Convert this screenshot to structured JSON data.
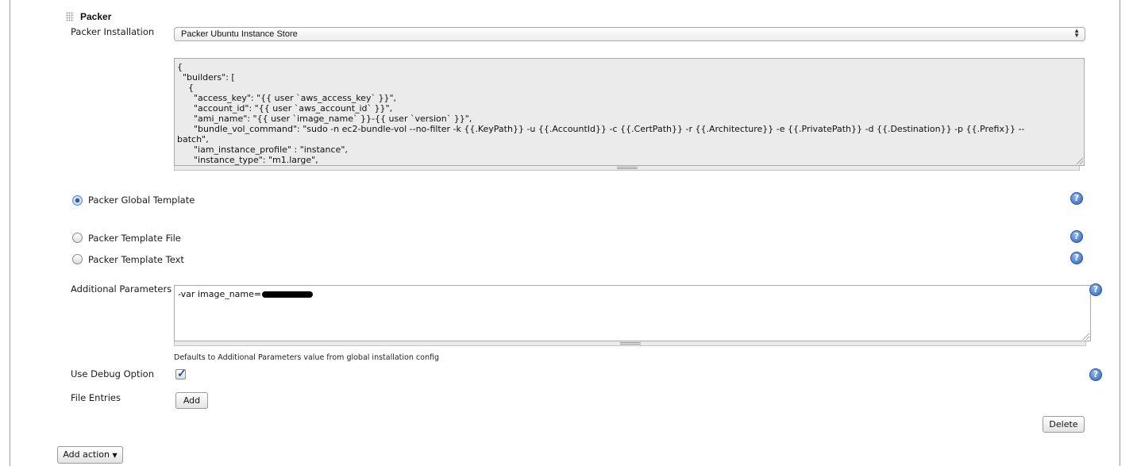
{
  "section": {
    "title": "Packer"
  },
  "installation": {
    "label": "Packer Installation",
    "selected": "Packer Ubuntu Instance Store"
  },
  "template_preview": {
    "lines": [
      "{",
      "  \"builders\": [",
      "    {",
      "      \"access_key\": \"{{ user `aws_access_key` }}\",",
      "      \"account_id\": \"{{ user `aws_account_id` }}\",",
      "      \"ami_name\": \"{{ user `image_name` }}-{{ user `version` }}\",",
      "      \"bundle_vol_command\": \"sudo -n ec2-bundle-vol --no-filter -k {{.KeyPath}} -u {{.AccountId}} -c {{.CertPath}} -r {{.Architecture}} -e {{.PrivatePath}} -d {{.Destination}} -p {{.Prefix}} --",
      "batch\",",
      "      \"iam_instance_profile\" : \"instance\",",
      "      \"instance_type\": \"m1.large\","
    ]
  },
  "template_options": {
    "global_label": "Packer Global Template",
    "file_label": "Packer Template File",
    "text_label": "Packer Template Text",
    "selected": "global"
  },
  "additional_parameters": {
    "label": "Additional Parameters",
    "value": "-var image_name=",
    "hint": "Defaults to Additional Parameters value from global installation config"
  },
  "debug": {
    "label": "Use Debug Option",
    "checked": true
  },
  "file_entries": {
    "label": "File Entries",
    "add_label": "Add"
  },
  "actions": {
    "delete_label": "Delete",
    "add_action_label": "Add action",
    "add_action_caret": "▼"
  },
  "help": {
    "glyph": "?"
  },
  "colors": {
    "accent": "#2e64b5",
    "textarea_bg": "#ebebeb"
  }
}
